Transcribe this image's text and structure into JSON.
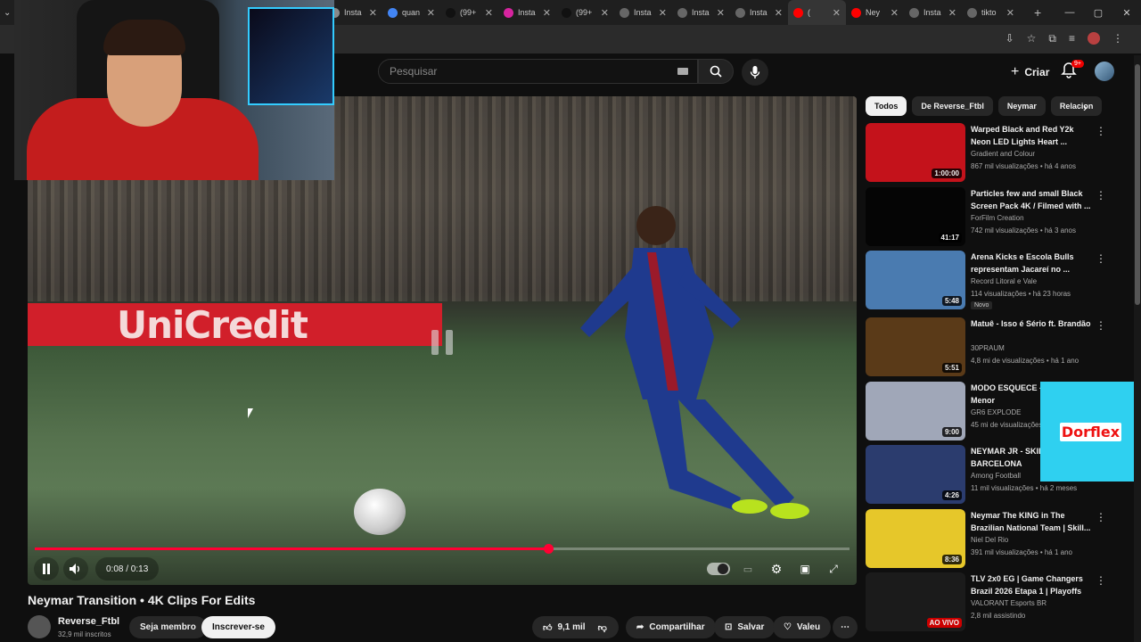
{
  "browser": {
    "tabs": [
      {
        "label": "Insta",
        "icon": "instagram-icon",
        "color": "#888"
      },
      {
        "label": "quan",
        "icon": "google-icon",
        "color": "#4285f4"
      },
      {
        "label": "(99+",
        "icon": "tiktok-icon",
        "color": "#111"
      },
      {
        "label": "Insta",
        "icon": "instagram-icon",
        "color": "#d6249f"
      },
      {
        "label": "(99+",
        "icon": "tiktok-icon",
        "color": "#111"
      },
      {
        "label": "Insta",
        "icon": "threads-icon",
        "color": "#666"
      },
      {
        "label": "Insta",
        "icon": "threads-icon",
        "color": "#666"
      },
      {
        "label": "Insta",
        "icon": "threads-icon",
        "color": "#666"
      },
      {
        "label": "(",
        "icon": "youtube-icon",
        "color": "#f00",
        "active": true
      },
      {
        "label": "Ney",
        "icon": "youtube-icon",
        "color": "#f00"
      },
      {
        "label": "Insta",
        "icon": "threads-icon",
        "color": "#666"
      },
      {
        "label": "tikto",
        "icon": "threads-icon",
        "color": "#666"
      }
    ],
    "new_tab": "+"
  },
  "header": {
    "search_placeholder": "Pesquisar",
    "create_label": "Criar",
    "notif_badge": "9+"
  },
  "player": {
    "time": "0:08 / 0:13",
    "progress": 0.63,
    "adboard": "UniCredit"
  },
  "video": {
    "title": "Neymar Transition • 4K Clips For Edits",
    "channel": "Reverse_Ftbl",
    "subs": "32,9 mil inscritos",
    "join": "Seja membro",
    "subscribe": "Inscrever-se",
    "likes": "9,1 mil",
    "share": "Compartilhar",
    "save": "Salvar",
    "thanks": "Valeu"
  },
  "chips": [
    "Todos",
    "De Reverse_Ftbl",
    "Neymar",
    "Relacion"
  ],
  "recs": [
    {
      "title": "Warped Black and Red Y2k Neon LED Lights Heart ...",
      "channel": "Gradient and Colour",
      "meta": "867 mil visualizações • há 4 anos",
      "dur": "1:00:00",
      "color": "#c4121b"
    },
    {
      "title": "Particles few and small Black Screen Pack 4K / Filmed with ...",
      "channel": "ForFilm Creation",
      "meta": "742 mil visualizações • há 3 anos",
      "dur": "41:17",
      "color": "#050505"
    },
    {
      "title": "Arena Kicks e Escola Bulls representam Jacareí no ...",
      "channel": "Record Litoral e Vale",
      "meta": "114 visualizações • há 23 horas",
      "dur": "5:48",
      "color": "#4a7bb0",
      "new": "Novo"
    },
    {
      "title": "Matuê - Isso é Sério ft. Brandão",
      "channel": "30PRAUM",
      "meta": "4,8 mi de visualizações • há 1 ano",
      "dur": "5:51",
      "color": "#5a3a18"
    },
    {
      "title": "MODO ESQUECE - TrapLaudo, Menor",
      "channel": "GR6 EXPLODE",
      "meta": "45 mi de visualizações",
      "dur": "9:00",
      "color": "#a0a7b8"
    },
    {
      "title": "NEYMAR JR - SKIL FC BARCELONA",
      "channel": "Among Football",
      "meta": "11 mil visualizações • há 2 meses",
      "dur": "4:26",
      "color": "#2b3c6e"
    },
    {
      "title": "Neymar The KING in The Brazilian National Team | Skill...",
      "channel": "Niel Del Rio",
      "meta": "391 mil visualizações • há 1 ano",
      "dur": "8:36",
      "color": "#e6c72a"
    },
    {
      "title": "TLV 2x0 EG | Game Changers Brazil 2026 Etapa 1 | Playoffs -...",
      "channel": "VALORANT Esports BR",
      "meta": "2,8 mil assistindo",
      "dur": "AO VIVO",
      "color": "#1b1b1b",
      "live": true
    }
  ],
  "ad": {
    "brand": "Dorflex"
  }
}
